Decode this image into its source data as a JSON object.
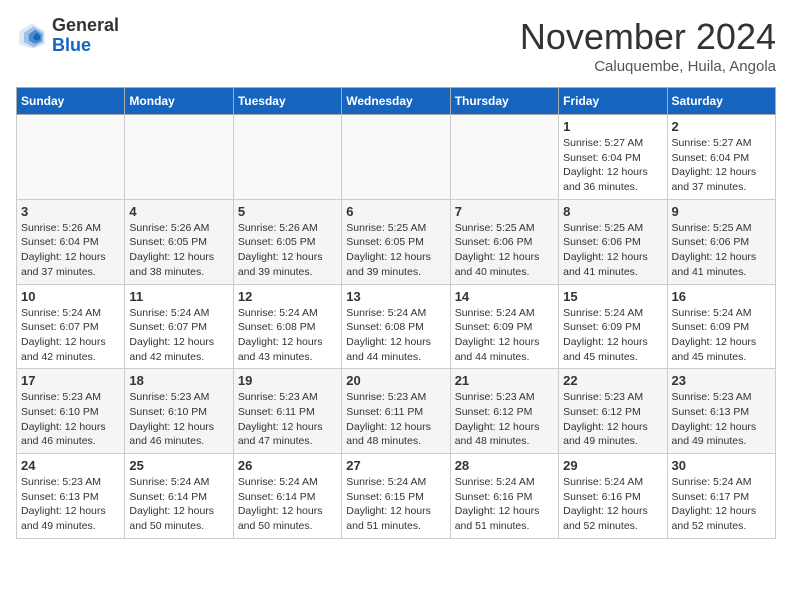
{
  "header": {
    "logo_general": "General",
    "logo_blue": "Blue",
    "month_title": "November 2024",
    "location": "Caluquembe, Huila, Angola"
  },
  "weekdays": [
    "Sunday",
    "Monday",
    "Tuesday",
    "Wednesday",
    "Thursday",
    "Friday",
    "Saturday"
  ],
  "weeks": [
    [
      {
        "day": "",
        "info": ""
      },
      {
        "day": "",
        "info": ""
      },
      {
        "day": "",
        "info": ""
      },
      {
        "day": "",
        "info": ""
      },
      {
        "day": "",
        "info": ""
      },
      {
        "day": "1",
        "info": "Sunrise: 5:27 AM\nSunset: 6:04 PM\nDaylight: 12 hours\nand 36 minutes."
      },
      {
        "day": "2",
        "info": "Sunrise: 5:27 AM\nSunset: 6:04 PM\nDaylight: 12 hours\nand 37 minutes."
      }
    ],
    [
      {
        "day": "3",
        "info": "Sunrise: 5:26 AM\nSunset: 6:04 PM\nDaylight: 12 hours\nand 37 minutes."
      },
      {
        "day": "4",
        "info": "Sunrise: 5:26 AM\nSunset: 6:05 PM\nDaylight: 12 hours\nand 38 minutes."
      },
      {
        "day": "5",
        "info": "Sunrise: 5:26 AM\nSunset: 6:05 PM\nDaylight: 12 hours\nand 39 minutes."
      },
      {
        "day": "6",
        "info": "Sunrise: 5:25 AM\nSunset: 6:05 PM\nDaylight: 12 hours\nand 39 minutes."
      },
      {
        "day": "7",
        "info": "Sunrise: 5:25 AM\nSunset: 6:06 PM\nDaylight: 12 hours\nand 40 minutes."
      },
      {
        "day": "8",
        "info": "Sunrise: 5:25 AM\nSunset: 6:06 PM\nDaylight: 12 hours\nand 41 minutes."
      },
      {
        "day": "9",
        "info": "Sunrise: 5:25 AM\nSunset: 6:06 PM\nDaylight: 12 hours\nand 41 minutes."
      }
    ],
    [
      {
        "day": "10",
        "info": "Sunrise: 5:24 AM\nSunset: 6:07 PM\nDaylight: 12 hours\nand 42 minutes."
      },
      {
        "day": "11",
        "info": "Sunrise: 5:24 AM\nSunset: 6:07 PM\nDaylight: 12 hours\nand 42 minutes."
      },
      {
        "day": "12",
        "info": "Sunrise: 5:24 AM\nSunset: 6:08 PM\nDaylight: 12 hours\nand 43 minutes."
      },
      {
        "day": "13",
        "info": "Sunrise: 5:24 AM\nSunset: 6:08 PM\nDaylight: 12 hours\nand 44 minutes."
      },
      {
        "day": "14",
        "info": "Sunrise: 5:24 AM\nSunset: 6:09 PM\nDaylight: 12 hours\nand 44 minutes."
      },
      {
        "day": "15",
        "info": "Sunrise: 5:24 AM\nSunset: 6:09 PM\nDaylight: 12 hours\nand 45 minutes."
      },
      {
        "day": "16",
        "info": "Sunrise: 5:24 AM\nSunset: 6:09 PM\nDaylight: 12 hours\nand 45 minutes."
      }
    ],
    [
      {
        "day": "17",
        "info": "Sunrise: 5:23 AM\nSunset: 6:10 PM\nDaylight: 12 hours\nand 46 minutes."
      },
      {
        "day": "18",
        "info": "Sunrise: 5:23 AM\nSunset: 6:10 PM\nDaylight: 12 hours\nand 46 minutes."
      },
      {
        "day": "19",
        "info": "Sunrise: 5:23 AM\nSunset: 6:11 PM\nDaylight: 12 hours\nand 47 minutes."
      },
      {
        "day": "20",
        "info": "Sunrise: 5:23 AM\nSunset: 6:11 PM\nDaylight: 12 hours\nand 48 minutes."
      },
      {
        "day": "21",
        "info": "Sunrise: 5:23 AM\nSunset: 6:12 PM\nDaylight: 12 hours\nand 48 minutes."
      },
      {
        "day": "22",
        "info": "Sunrise: 5:23 AM\nSunset: 6:12 PM\nDaylight: 12 hours\nand 49 minutes."
      },
      {
        "day": "23",
        "info": "Sunrise: 5:23 AM\nSunset: 6:13 PM\nDaylight: 12 hours\nand 49 minutes."
      }
    ],
    [
      {
        "day": "24",
        "info": "Sunrise: 5:23 AM\nSunset: 6:13 PM\nDaylight: 12 hours\nand 49 minutes."
      },
      {
        "day": "25",
        "info": "Sunrise: 5:24 AM\nSunset: 6:14 PM\nDaylight: 12 hours\nand 50 minutes."
      },
      {
        "day": "26",
        "info": "Sunrise: 5:24 AM\nSunset: 6:14 PM\nDaylight: 12 hours\nand 50 minutes."
      },
      {
        "day": "27",
        "info": "Sunrise: 5:24 AM\nSunset: 6:15 PM\nDaylight: 12 hours\nand 51 minutes."
      },
      {
        "day": "28",
        "info": "Sunrise: 5:24 AM\nSunset: 6:16 PM\nDaylight: 12 hours\nand 51 minutes."
      },
      {
        "day": "29",
        "info": "Sunrise: 5:24 AM\nSunset: 6:16 PM\nDaylight: 12 hours\nand 52 minutes."
      },
      {
        "day": "30",
        "info": "Sunrise: 5:24 AM\nSunset: 6:17 PM\nDaylight: 12 hours\nand 52 minutes."
      }
    ]
  ]
}
